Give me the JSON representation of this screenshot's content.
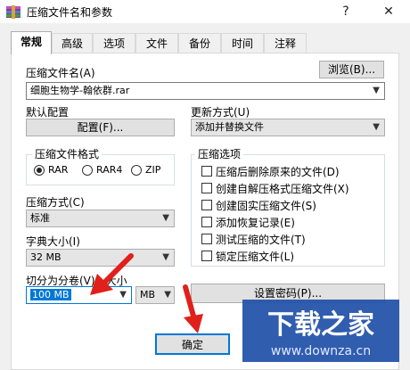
{
  "window": {
    "title": "压缩文件名和参数",
    "help_label": "?",
    "close_label": "✕"
  },
  "tabs": [
    "常规",
    "高级",
    "选项",
    "文件",
    "备份",
    "时间",
    "注释"
  ],
  "archive_name": {
    "label": "压缩文件名(A)",
    "value": "细胞生物学-翰依群.rar",
    "browse_label": "浏览(B)..."
  },
  "profile": {
    "label": "默认配置",
    "button_label": "配置(F)..."
  },
  "update_mode": {
    "label": "更新方式(U)",
    "value": "添加并替换文件"
  },
  "format": {
    "label": "压缩文件格式",
    "options": [
      "RAR",
      "RAR4",
      "ZIP"
    ],
    "selected": "RAR"
  },
  "method": {
    "label": "压缩方式(C)",
    "value": "标准"
  },
  "dictionary": {
    "label": "字典大小(I)",
    "value": "32 MB"
  },
  "split": {
    "label": "切分为分卷(V)，大小",
    "value": "100 MB",
    "unit": "MB"
  },
  "options_group": {
    "label": "压缩选项",
    "items": [
      {
        "label": "压缩后删除原来的文件(D)",
        "checked": false
      },
      {
        "label": "创建自解压格式压缩文件(X)",
        "checked": false
      },
      {
        "label": "创建固实压缩文件(S)",
        "checked": false
      },
      {
        "label": "添加恢复记录(E)",
        "checked": false
      },
      {
        "label": "测试压缩的文件(T)",
        "checked": false
      },
      {
        "label": "锁定压缩文件(L)",
        "checked": false
      }
    ]
  },
  "password_button_label": "设置密码(P)...",
  "ok_button_label": "确定",
  "watermark": {
    "brand": "下载之家",
    "url": "www.downza.cn"
  },
  "colors": {
    "accent": "#0078d7",
    "arrow": "#e0201b",
    "selection": "#0078d7"
  }
}
